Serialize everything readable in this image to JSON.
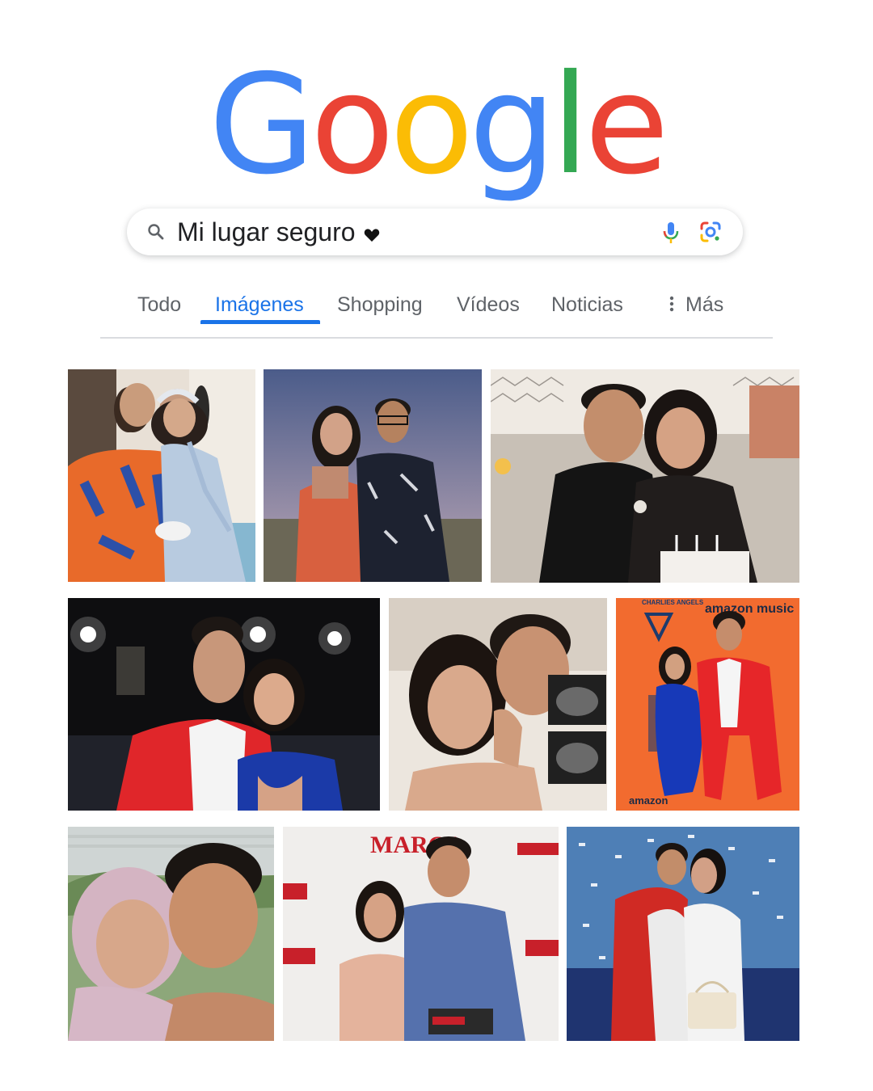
{
  "logo": {
    "letters": [
      "G",
      "o",
      "o",
      "g",
      "l",
      "e"
    ],
    "colors": [
      "#4285F4",
      "#EA4335",
      "#FBBC05",
      "#4285F4",
      "#34A853",
      "#EA4335"
    ]
  },
  "search": {
    "query": "Mi lugar seguro",
    "icons": [
      "search-icon",
      "heart-icon",
      "microphone-icon",
      "google-lens-icon"
    ]
  },
  "tabs": [
    {
      "label": "Todo",
      "active": false
    },
    {
      "label": "Imágenes",
      "active": true
    },
    {
      "label": "Shopping",
      "active": false
    },
    {
      "label": "Vídeos",
      "active": false
    },
    {
      "label": "Noticias",
      "active": false
    },
    {
      "label": "Más",
      "active": false
    }
  ],
  "colors": {
    "accent": "#1a73e8",
    "tab_inactive": "#5f6368",
    "divider": "#dadce0"
  },
  "images": {
    "photo_labels": {
      "charlies_angels": "CHARLIES ANGELS",
      "amazon_music": "amazon music",
      "amazon": "amazon",
      "marca": "MARCA"
    }
  }
}
